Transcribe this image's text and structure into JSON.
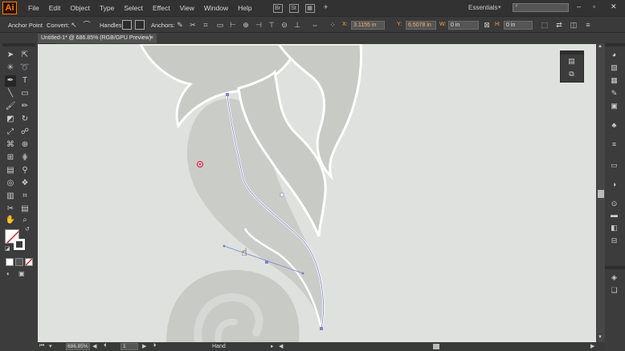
{
  "app": {
    "logo": "Ai"
  },
  "menu": [
    "File",
    "Edit",
    "Object",
    "Type",
    "Select",
    "Effect",
    "View",
    "Window",
    "Help"
  ],
  "workspace": {
    "label": "Essentials",
    "search_placeholder": ""
  },
  "control_bar": {
    "tool_name": "Anchor Point",
    "convert_label": "Convert:",
    "handles_label": "Handles:",
    "anchors_label": "Anchors:",
    "x_label": "X:",
    "x_value": "3.1155 in",
    "y_label": "Y:",
    "y_value": "6.5078 in",
    "w_label": "W:",
    "w_value": "0 in",
    "h_label": "H:",
    "h_value": "0 in"
  },
  "document": {
    "tab_title": "Untitled-1* @ 686.85% (RGB/GPU Preview)",
    "tab_close": "×"
  },
  "status": {
    "zoom": "686.85%",
    "page": "1",
    "tool": "Hand"
  },
  "colors": {
    "canvas": "#dfe1df",
    "shape_fill": "#c8cac6",
    "path_stroke": "#7a86c8",
    "anchor_point": "#d8304a",
    "accent": "#ff7c00"
  },
  "icons": {
    "tools": [
      "selection-tool-icon",
      "direct-selection-tool-icon",
      "magic-wand-icon",
      "lasso-icon",
      "pen-tool-icon",
      "type-tool-icon",
      "line-tool-icon",
      "rectangle-tool-icon",
      "paintbrush-icon",
      "pencil-icon",
      "eraser-icon",
      "rotate-icon",
      "scale-icon",
      "warp-icon",
      "free-transform-icon",
      "shape-builder-icon",
      "perspective-grid-icon",
      "mesh-icon",
      "gradient-icon",
      "eyedropper-icon",
      "blend-icon",
      "symbol-sprayer-icon",
      "column-graph-icon",
      "artboard-icon",
      "slice-icon",
      "hand-icon",
      "zoom-icon"
    ],
    "dock": [
      "color-icon",
      "color-guide-icon",
      "swatches-icon",
      "brushes-icon",
      "symbols-icon",
      "stroke-icon",
      "gradient-icon",
      "transparency-icon",
      "appearance-icon",
      "graphic-styles-icon",
      "layers-icon"
    ]
  }
}
